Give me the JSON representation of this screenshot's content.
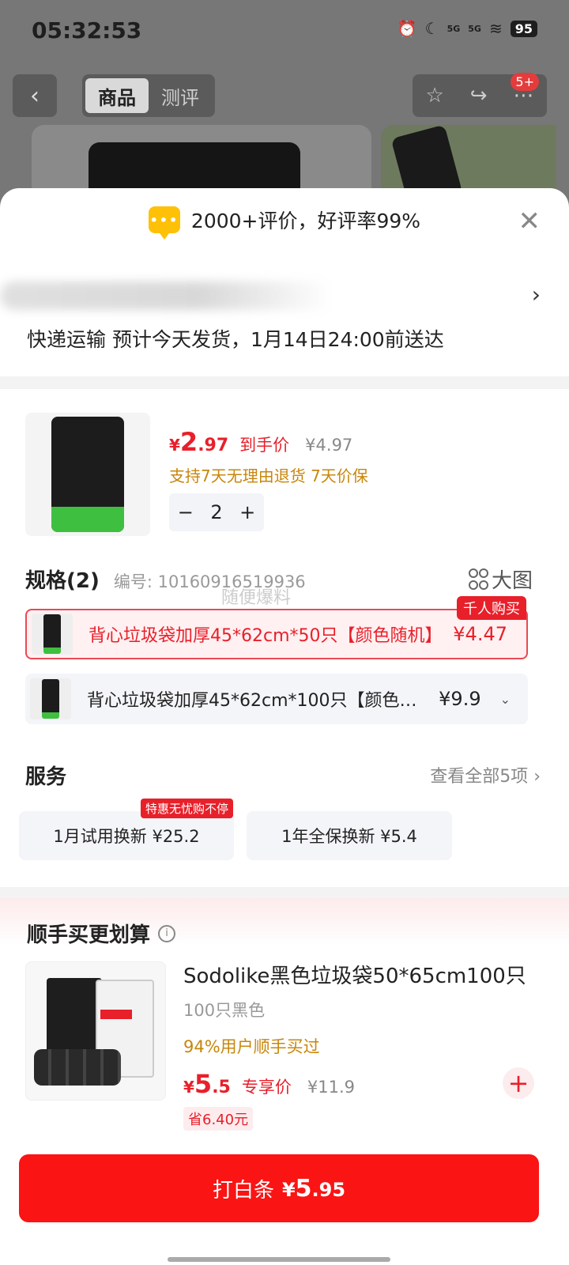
{
  "status_bar": {
    "time": "05:32:53",
    "battery": "95",
    "sig1": "5G",
    "sig2": "5G"
  },
  "top_nav": {
    "tabs": [
      "商品",
      "测评"
    ],
    "badge": "5+"
  },
  "sheet": {
    "rating_text": "2000+评价，好评率99%",
    "delivery": "快递运输 预计今天发货，1月14日24:00前送达",
    "product": {
      "price_symbol": "¥",
      "price_int": "2",
      "price_dec": ".97",
      "price_tag": "到手价",
      "orig_price": "¥4.97",
      "return_policy": "支持7天无理由退货  7天价保",
      "quantity": "2"
    },
    "specs": {
      "title": "规格(2)",
      "number": "编号: 10160916519936",
      "big_pic": "大图",
      "watermark": "随便爆料",
      "options": [
        {
          "label": "背心垃圾袋加厚45*62cm*50只【颜色随机】",
          "price": "¥4.47",
          "badge": "千人购买"
        },
        {
          "label": "背心垃圾袋加厚45*62cm*100只【颜色…",
          "price": "¥9.9"
        }
      ]
    },
    "service": {
      "title": "服务",
      "view_all": "查看全部5项",
      "items": [
        {
          "label": "1月试用换新  ¥25.2",
          "badge": "特惠无忧购不停"
        },
        {
          "label": "1年全保换新  ¥5.4"
        }
      ]
    },
    "addon": {
      "title": "顺手买更划算",
      "name": "Sodolike黑色垃圾袋50*65cm100只",
      "spec": "100只黑色",
      "users": "94%用户顺手买过",
      "price_symbol": "¥",
      "price_int": "5",
      "price_dec": ".5",
      "price_tag": "专享价",
      "orig_price": "¥11.9",
      "save": "省6.40元"
    },
    "buy_button": {
      "label": "打白条",
      "symbol": "¥",
      "int": "5",
      "dec": ".95"
    }
  }
}
